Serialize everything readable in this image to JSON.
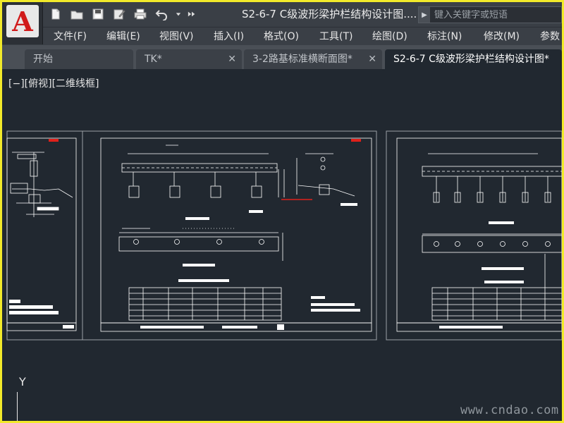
{
  "app": {
    "logo_letter": "A",
    "window_title": "S2-6-7 C级波形梁护栏结构设计图....",
    "search_placeholder": "键入关键字或短语"
  },
  "quick_access": [
    {
      "icon": "new-file-icon"
    },
    {
      "icon": "open-folder-icon"
    },
    {
      "icon": "save-icon"
    },
    {
      "icon": "save-as-icon"
    },
    {
      "icon": "print-icon"
    },
    {
      "icon": "undo-icon"
    },
    {
      "icon": "dropdown-icon"
    },
    {
      "icon": "more-icon"
    }
  ],
  "menu": [
    {
      "label": "文件(F)"
    },
    {
      "label": "编辑(E)"
    },
    {
      "label": "视图(V)"
    },
    {
      "label": "插入(I)"
    },
    {
      "label": "格式(O)"
    },
    {
      "label": "工具(T)"
    },
    {
      "label": "绘图(D)"
    },
    {
      "label": "标注(N)"
    },
    {
      "label": "修改(M)"
    },
    {
      "label": "参数"
    }
  ],
  "tabs": [
    {
      "label": "开始",
      "active": false
    },
    {
      "label": "TK*",
      "active": false
    },
    {
      "label": "3-2路基标准横断面图*",
      "active": false
    },
    {
      "label": "S2-6-7 C级波形梁护栏结构设计图*",
      "active": true
    }
  ],
  "viewport": {
    "label": "[−][俯视][二维线框]",
    "ucs_axis": "Y",
    "watermark": "www.cndao.com"
  },
  "colors": {
    "accent_red": "#d11b1b",
    "canvas": "#212830",
    "drawing_lines": "#ffffff",
    "highlight_red": "#e0201a"
  }
}
